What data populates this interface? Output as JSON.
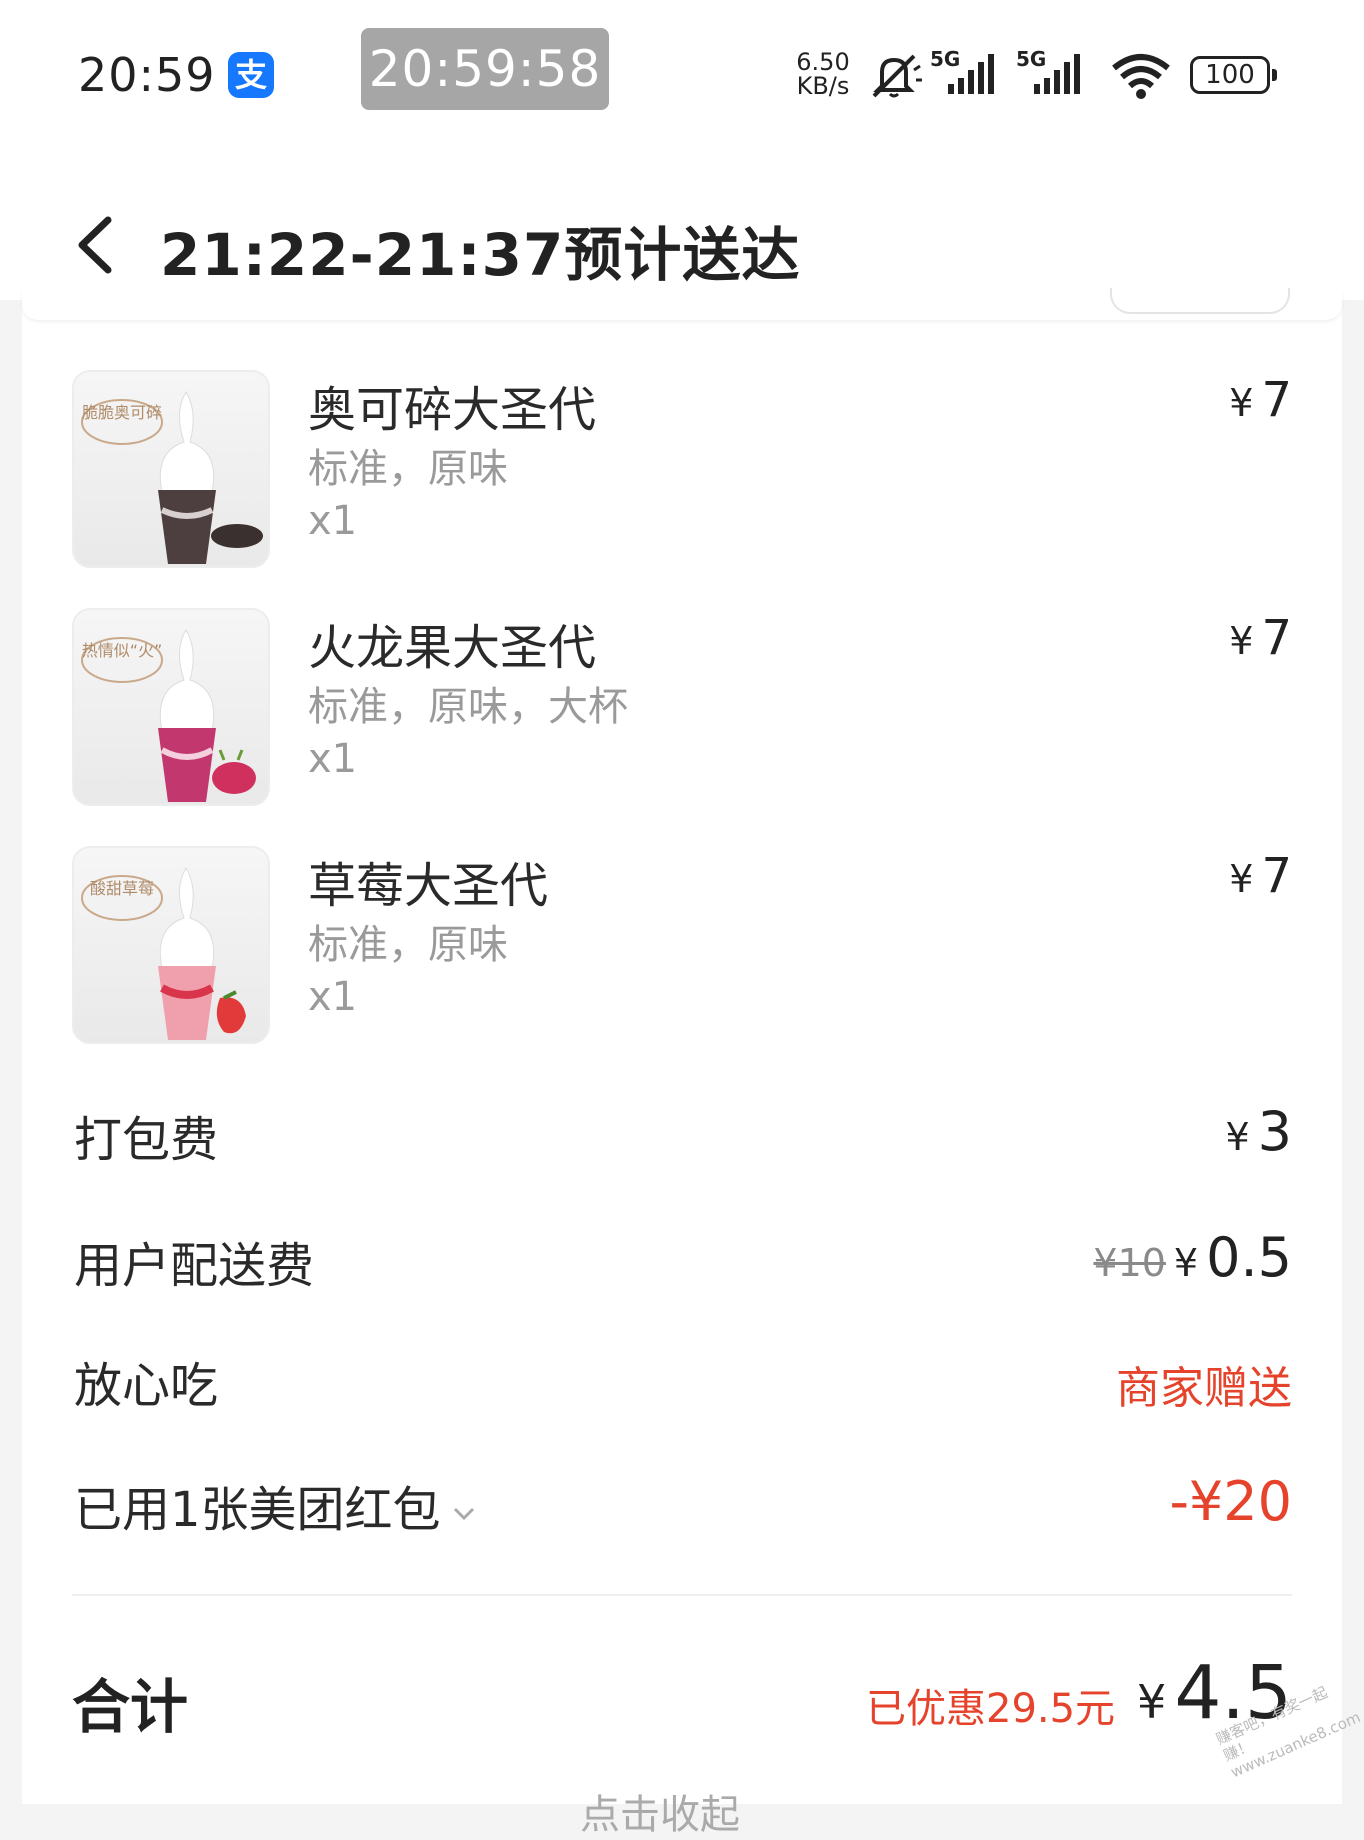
{
  "status_bar": {
    "time": "20:59",
    "clock_overlay": "20:59:58",
    "net_speed_value": "6.50",
    "net_speed_unit": "KB/s",
    "signal_label_1": "5G",
    "signal_label_2": "5G",
    "battery": "100",
    "app_icon_glyph": "支"
  },
  "header": {
    "title": "21:22-21:37预计送达"
  },
  "items": [
    {
      "name": "奥可碎大圣代",
      "spec": "标准，原味",
      "qty": "x1",
      "price": "7",
      "currency": "¥",
      "badge": "脆脆奥可碎",
      "accent": "#5a4a4a"
    },
    {
      "name": "火龙果大圣代",
      "spec": "标准，原味，大杯",
      "qty": "x1",
      "price": "7",
      "currency": "¥",
      "badge": "热情似“火”",
      "accent": "#c2386e"
    },
    {
      "name": "草莓大圣代",
      "spec": "标准，原味",
      "qty": "x1",
      "price": "7",
      "currency": "¥",
      "badge": "酸甜草莓",
      "accent": "#d8344a"
    }
  ],
  "fees": {
    "packing_label": "打包费",
    "packing_currency": "¥",
    "packing_value": "3",
    "delivery_label": "用户配送费",
    "delivery_original": "¥10",
    "delivery_currency": "¥",
    "delivery_value": "0.5",
    "safe_label": "放心吃",
    "safe_value": "商家赠送",
    "coupon_label": "已用1张美团红包",
    "coupon_value": "-¥20"
  },
  "total": {
    "label": "合计",
    "saved": "已优惠29.5元",
    "currency": "¥",
    "value": "4.5",
    "collapse": "点击收起"
  },
  "watermark": "赚客吧，有奖一起赚！ www.zuanke8.com",
  "colors": {
    "accent_red": "#e5432b",
    "alipay_blue": "#1677ff"
  }
}
